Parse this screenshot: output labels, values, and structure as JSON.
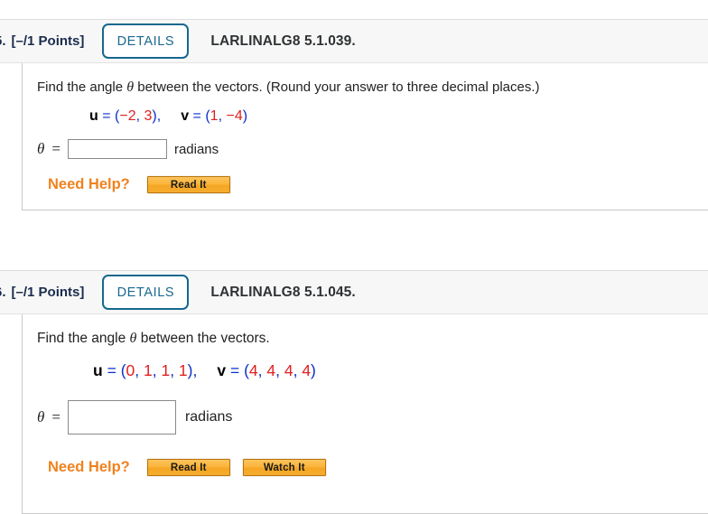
{
  "page": {
    "background": "#ffffff",
    "accent_blue": "#16688e",
    "accent_orange": "#f0821e",
    "number_red": "#e02020",
    "punct_blue": "#0b30cc",
    "header_band": "#f7f7f7"
  },
  "questions": [
    {
      "number": "5.",
      "points": "[–/1 Points]",
      "details_label": "DETAILS",
      "title": "LARLINALG8 5.1.039.",
      "prompt_before_theta": "Find the angle ",
      "theta_symbol": "θ",
      "prompt_after_theta": " between the vectors. (Round your answer to three decimal places.)",
      "vectors": {
        "u_name": "u",
        "u_equals": "=",
        "u_open": "(",
        "u_components": [
          "−2",
          "3"
        ],
        "u_close": ")",
        "u_trailing_comma": ",",
        "v_name": "v",
        "v_equals": "=",
        "v_open": "(",
        "v_components": [
          "1",
          "−4"
        ],
        "v_close": ")",
        "separator": ", "
      },
      "answer": {
        "label": "θ",
        "equals": "=",
        "value": "",
        "placeholder": "",
        "units": "radians"
      },
      "help": {
        "label": "Need Help?",
        "buttons": [
          "Read It"
        ]
      }
    },
    {
      "number": "6.",
      "points": "[–/1 Points]",
      "details_label": "DETAILS",
      "title": "LARLINALG8 5.1.045.",
      "prompt_before_theta": "Find the angle ",
      "theta_symbol": "θ",
      "prompt_after_theta": " between the vectors.",
      "vectors": {
        "u_name": "u",
        "u_equals": "=",
        "u_open": "(",
        "u_components": [
          "0",
          "1",
          "1",
          "1"
        ],
        "u_close": ")",
        "u_trailing_comma": ",",
        "v_name": "v",
        "v_equals": "=",
        "v_open": "(",
        "v_components": [
          "4",
          "4",
          "4",
          "4"
        ],
        "v_close": ")",
        "separator": ", "
      },
      "answer": {
        "label": "θ",
        "equals": "=",
        "value": "",
        "placeholder": "",
        "units": "radians"
      },
      "help": {
        "label": "Need Help?",
        "buttons": [
          "Read It",
          "Watch It"
        ]
      }
    }
  ]
}
